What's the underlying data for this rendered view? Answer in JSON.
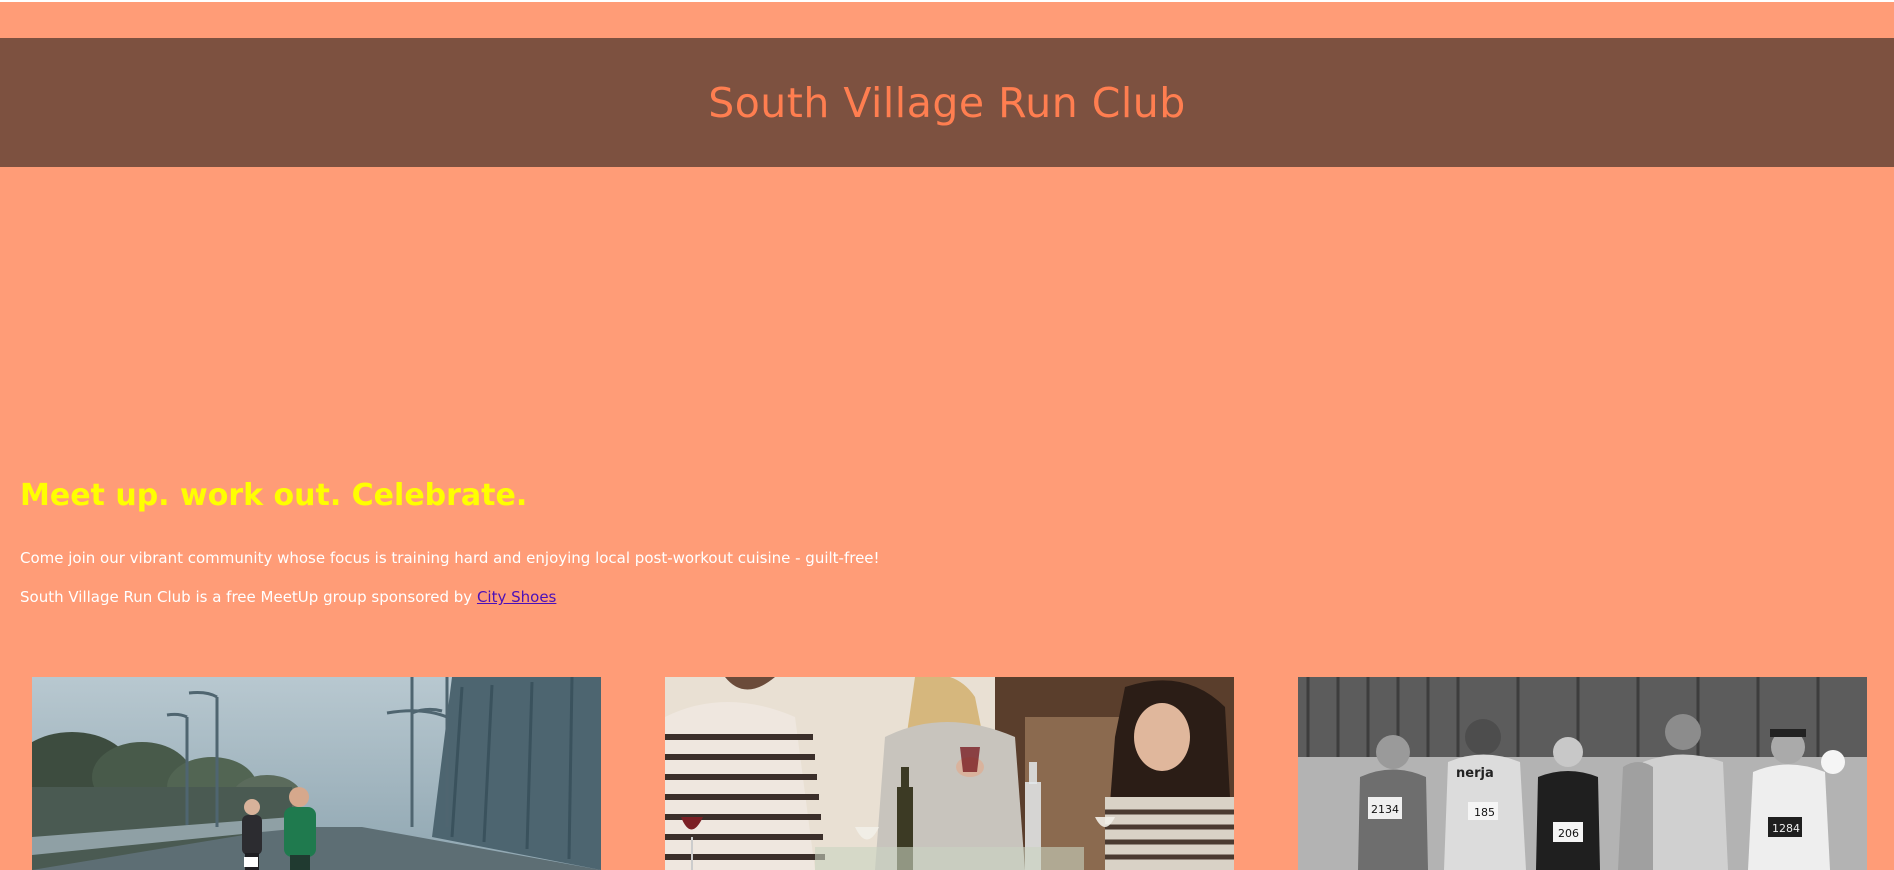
{
  "header": {
    "title": "South Village Run Club"
  },
  "intro": {
    "tagline": "Meet up. work out. Celebrate.",
    "description": "Come join our vibrant community whose focus is training hard and enjoying local post-workout cuisine - guilt-free!",
    "sponsor_text": "South Village Run Club is a free MeetUp group sponsored by ",
    "sponsor_link": "City Shoes"
  },
  "photos": [
    {
      "name": "runners-on-bridge-photo",
      "bib": ""
    },
    {
      "name": "friends-dining-photo"
    },
    {
      "name": "marathon-runners-photo",
      "bibs": [
        "2134",
        "185",
        "206",
        "1284"
      ]
    }
  ],
  "colors": {
    "background": "#ff9c77",
    "header_bg": "#7d5140",
    "title": "#ff7e50",
    "tagline": "#ffff00",
    "body_text": "#ffffff",
    "link": "#4b10b8"
  }
}
